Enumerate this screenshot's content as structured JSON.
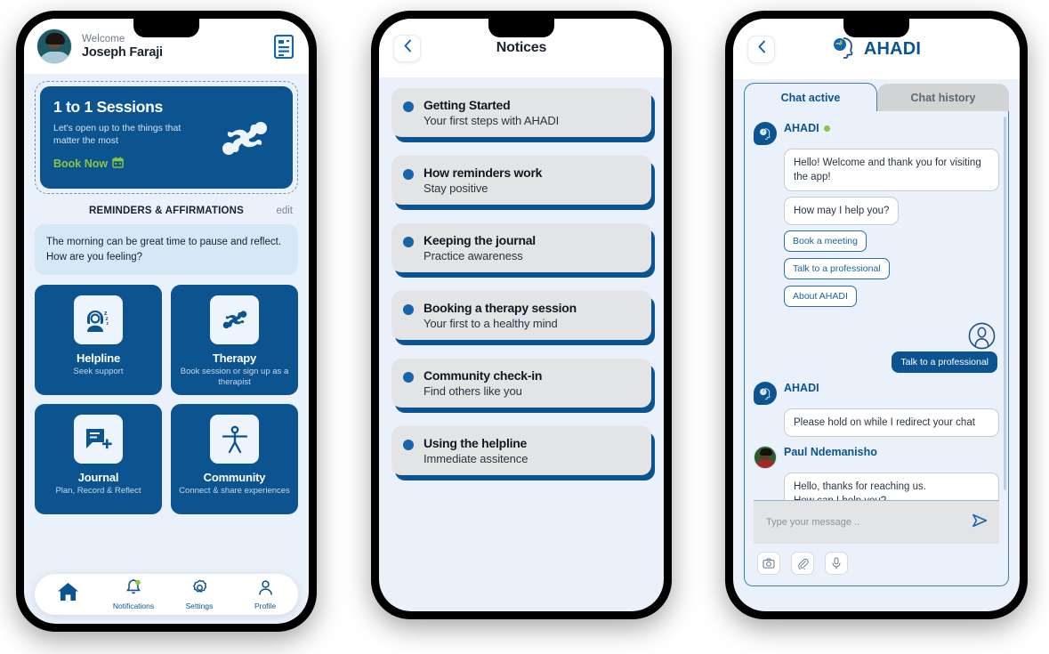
{
  "brand": {
    "name": "AHADI",
    "primary": "#0b5490",
    "accent_green": "#8cc63f",
    "bubble_blue": "#1565ab"
  },
  "phone1": {
    "header": {
      "welcome_label": "Welcome",
      "user_name": "Joseph Faraji",
      "notices_icon": "document-icon"
    },
    "hero": {
      "title": "1 to 1 Sessions",
      "subtitle": "Let's open up to the things that matter the most",
      "cta": "Book Now",
      "cta_icon": "calendar-icon",
      "logo_icon": "therapy-people-icon"
    },
    "section": {
      "title": "REMINDERS & AFFIRMATIONS",
      "edit": "edit"
    },
    "affirmation": "The morning can be great time to pause and reflect. How are you feeling?",
    "tiles": [
      {
        "name": "Helpline",
        "desc": "Seek support",
        "icon": "headset-support-icon"
      },
      {
        "name": "Therapy",
        "desc": "Book session or sign up as a therapist",
        "icon": "therapy-people-icon"
      },
      {
        "name": "Journal",
        "desc": "Plan, Record  & Reflect",
        "icon": "journal-add-icon"
      },
      {
        "name": "Community",
        "desc": "Connect & share experiences",
        "icon": "accessibility-person-icon"
      }
    ],
    "tabbar": [
      {
        "label": "",
        "icon": "home-icon",
        "active": true
      },
      {
        "label": "Notifications",
        "icon": "bell-icon",
        "active": false
      },
      {
        "label": "Settings",
        "icon": "gear-icon",
        "active": false
      },
      {
        "label": "Profile",
        "icon": "person-icon",
        "active": false
      }
    ]
  },
  "phone2": {
    "header": {
      "title": "Notices",
      "back_icon": "chevron-left-icon"
    },
    "notices": [
      {
        "title": "Getting Started",
        "subtitle": "Your first steps with AHADI"
      },
      {
        "title": "How reminders work",
        "subtitle": "Stay positive"
      },
      {
        "title": "Keeping the journal",
        "subtitle": "Practice awareness"
      },
      {
        "title": "Booking a therapy session",
        "subtitle": "Your first to a healthy mind"
      },
      {
        "title": "Community check-in",
        "subtitle": "Find others like you"
      },
      {
        "title": "Using the helpline",
        "subtitle": "Immediate assitence"
      }
    ]
  },
  "phone3": {
    "header": {
      "title": "AHADI",
      "back_icon": "chevron-left-icon",
      "logo_icon": "ahadi-head-leaf-icon"
    },
    "tabs": [
      {
        "label": "Chat active",
        "active": true
      },
      {
        "label": "Chat history",
        "active": false
      }
    ],
    "chat": {
      "group1": {
        "sender": "AHADI",
        "online": true,
        "messages": [
          "Hello! Welcome and thank you for visiting the app!",
          "How may I help you?"
        ],
        "quick_replies": [
          "Book a meeting",
          "Talk to a professional",
          "About AHADI"
        ]
      },
      "user_message": "Talk to a professional",
      "group2": {
        "sender": "AHADI",
        "messages": [
          "Please hold on while I redirect your chat"
        ]
      },
      "group3": {
        "sender": "Paul Ndemanisho",
        "messages": [
          "Hello, thanks for reaching us.",
          "How can I help you?"
        ]
      }
    },
    "composer": {
      "placeholder": "Type your message ..",
      "send_icon": "send-icon",
      "actions": [
        "camera-icon",
        "attachment-icon",
        "microphone-icon"
      ]
    }
  }
}
